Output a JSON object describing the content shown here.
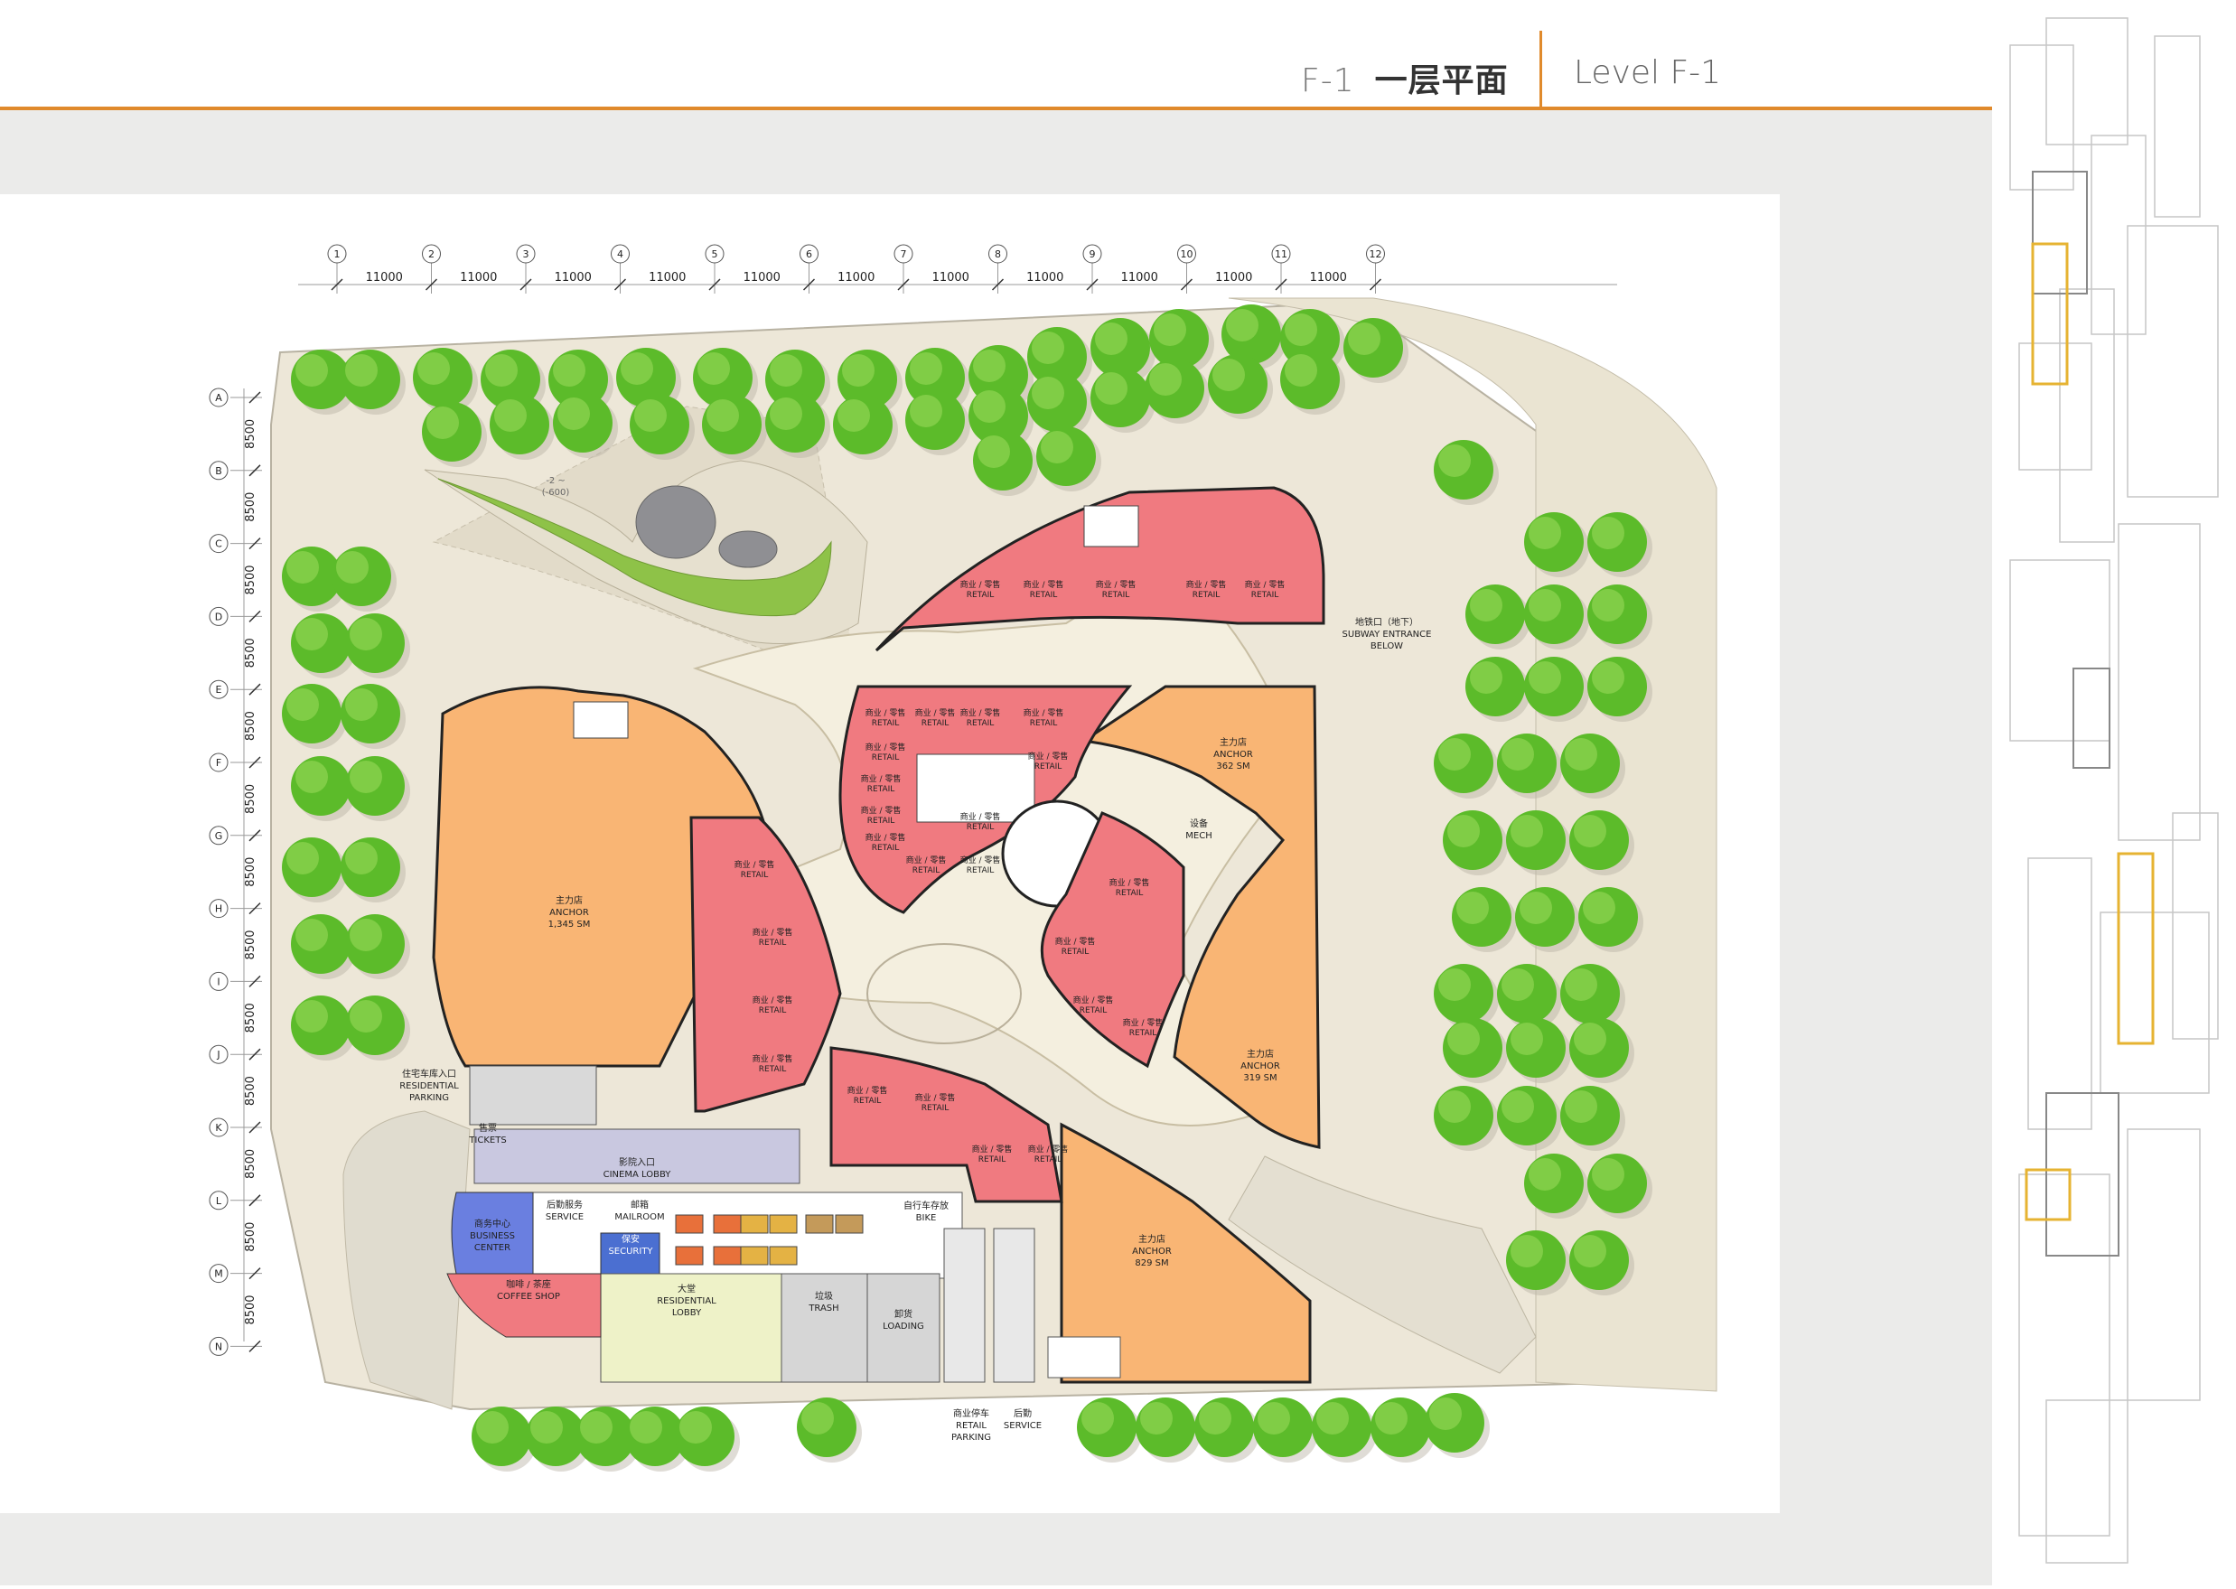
{
  "header": {
    "number": "F-1",
    "title_zh": "一层平面",
    "title_en": "Level F-1"
  },
  "colors": {
    "accent": "#e08a2c",
    "retail": "#f07a80",
    "anchor": "#f9b574",
    "tree": "#5cbb2a",
    "paving": "#ede7d8",
    "service": "#c9c8e0"
  },
  "grid": {
    "columns": [
      "1",
      "2",
      "3",
      "4",
      "5",
      "6",
      "7",
      "8",
      "9",
      "10",
      "11",
      "12"
    ],
    "column_spacing": "11000",
    "rows": [
      "A",
      "B",
      "C",
      "D",
      "E",
      "F",
      "G",
      "H",
      "I",
      "J",
      "K",
      "L",
      "M",
      "N"
    ],
    "row_spacing": "8500"
  },
  "labels": {
    "retail_zh": "商业 / 零售",
    "retail_en": "RETAIL",
    "anchor_zh": "主力店",
    "anchor_en": "ANCHOR",
    "anchor_area_left": "1,345 SM",
    "anchor_area_right_top": "362 SM",
    "anchor_area_right_mid": "319 SM",
    "anchor_area_bottom": "829 SM",
    "subway": [
      "地铁口（地下）",
      "SUBWAY ENTRANCE",
      "BELOW"
    ],
    "residential_parking": [
      "住宅车库入口",
      "RESIDENTIAL",
      "PARKING"
    ],
    "tickets": [
      "售票",
      "TICKETS"
    ],
    "cinema_lobby": [
      "影院入口",
      "CINEMA LOBBY"
    ],
    "service": [
      "后勤服务",
      "SERVICE"
    ],
    "mailroom": [
      "邮箱",
      "MAILROOM"
    ],
    "security": [
      "保安",
      "SECURITY"
    ],
    "business_center": [
      "商务中心",
      "BUSINESS",
      "CENTER"
    ],
    "coffee_shop": [
      "咖啡 / 茶座",
      "COFFEE SHOP"
    ],
    "residential_lobby": [
      "大堂",
      "RESIDENTIAL",
      "LOBBY"
    ],
    "trash": [
      "垃圾",
      "TRASH"
    ],
    "loading": [
      "卸货",
      "LOADING"
    ],
    "bike": [
      "自行车存放",
      "BIKE"
    ],
    "retail_parking": [
      "商业停车",
      "RETAIL",
      "PARKING"
    ],
    "service_entry": [
      "后勤",
      "SERVICE"
    ],
    "equipment": [
      "设备",
      "MECH"
    ],
    "level_minus": [
      "-2 ~",
      "(-600)"
    ]
  }
}
